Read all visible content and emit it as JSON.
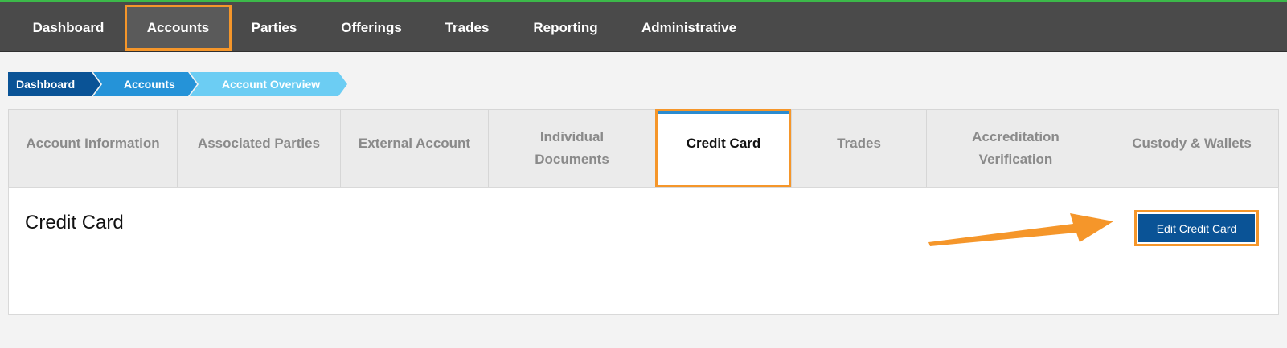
{
  "nav": {
    "items": [
      {
        "label": "Dashboard",
        "active": false
      },
      {
        "label": "Accounts",
        "active": true
      },
      {
        "label": "Parties",
        "active": false
      },
      {
        "label": "Offerings",
        "active": false
      },
      {
        "label": "Trades",
        "active": false
      },
      {
        "label": "Reporting",
        "active": false
      },
      {
        "label": "Administrative",
        "active": false
      }
    ]
  },
  "breadcrumb": {
    "items": [
      "Dashboard",
      "Accounts",
      "Account Overview"
    ]
  },
  "tabs": {
    "items": [
      {
        "line1": "Account Information",
        "line2": ""
      },
      {
        "line1": "Associated Parties",
        "line2": ""
      },
      {
        "line1": "External Account",
        "line2": ""
      },
      {
        "line1": "Individual",
        "line2": "Documents"
      },
      {
        "line1": "Credit Card",
        "line2": "",
        "active": true
      },
      {
        "line1": "Trades",
        "line2": ""
      },
      {
        "line1": "Accreditation",
        "line2": "Verification"
      },
      {
        "line1": "Custody & Wallets",
        "line2": ""
      }
    ]
  },
  "panel": {
    "title": "Credit Card",
    "edit_button_label": "Edit Credit Card"
  },
  "colors": {
    "nav_bg": "#4a4a4a",
    "accent_green": "#3cb94a",
    "highlight_orange": "#f5962a",
    "primary_blue": "#0a5396",
    "crumb_mid_blue": "#2593d8",
    "crumb_light_blue": "#6ccdf3"
  },
  "icons": {
    "annotation": "arrow-icon"
  }
}
